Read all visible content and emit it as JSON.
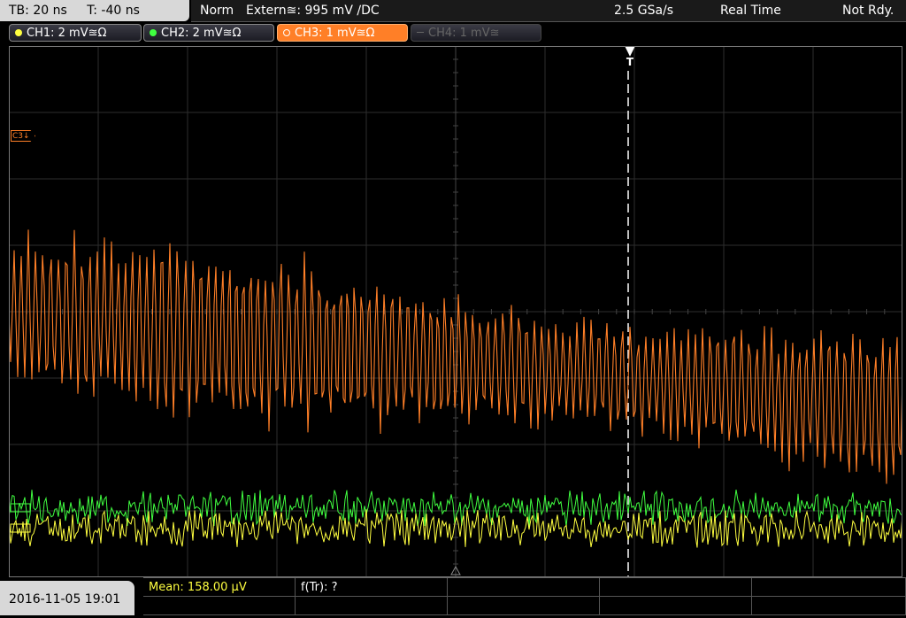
{
  "header": {
    "timebase": "TB: 20 ns",
    "trigger_offset": "T: -40 ns",
    "mode": "Norm",
    "trigger_source": "Extern≊: 995 mV ∕DC",
    "sample_rate": "2.5 GSa/s",
    "acq_mode": "Real Time",
    "status": "Not Rdy."
  },
  "channels": [
    {
      "label": "CH1: 2 mV≊Ω",
      "color": "#ffff40",
      "state": "on"
    },
    {
      "label": "CH2: 2 mV≊Ω",
      "color": "#40ff40",
      "state": "on"
    },
    {
      "label": "CH3: 1 mV≊Ω",
      "color": "#ff7f27",
      "state": "selected"
    },
    {
      "label": "CH4: 1 mV≊",
      "color": "#666666",
      "state": "off"
    }
  ],
  "markers": {
    "ch3_ref": "C3↓",
    "trigger": "T"
  },
  "footer": {
    "datetime": "2016-11-05 19:01",
    "measurement_1": "Mean: 158.00 µV",
    "measurement_2": "f(Tr): ?"
  },
  "icons": [
    "channel-dot-icon",
    "trigger-arrow-icon",
    "ground-marker-icon"
  ]
}
